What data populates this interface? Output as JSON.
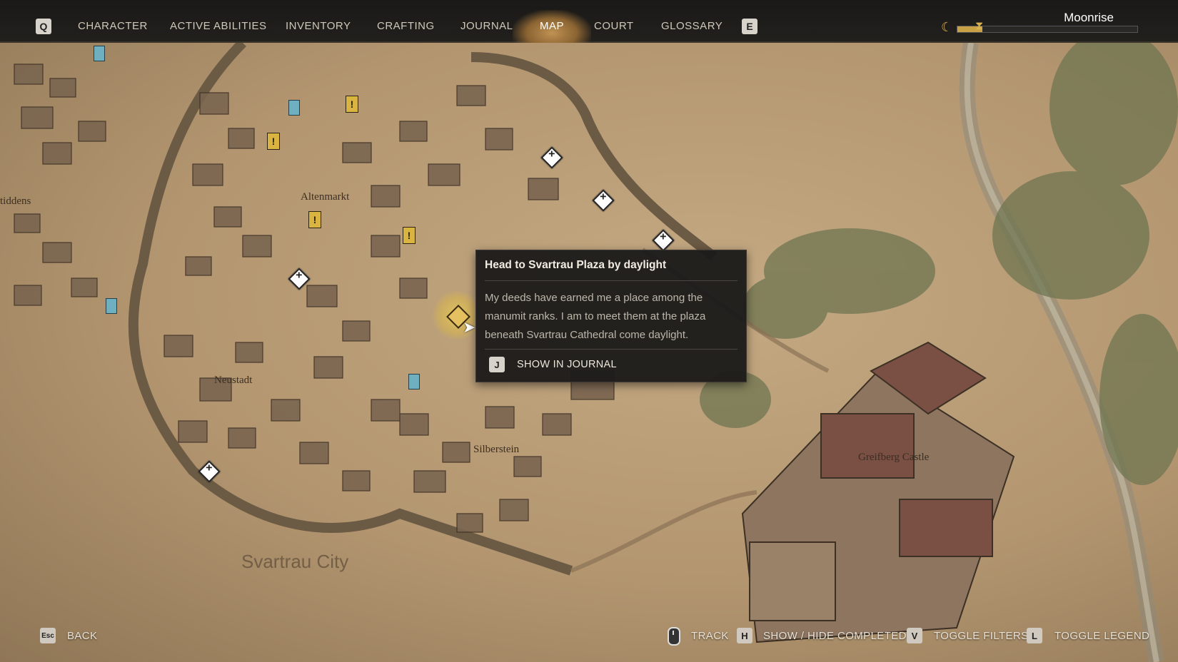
{
  "nav": {
    "left_key": "Q",
    "right_key": "E",
    "tabs": [
      {
        "label": "CHARACTER",
        "active": false
      },
      {
        "label": "ACTIVE ABILITIES",
        "active": false
      },
      {
        "label": "INVENTORY",
        "active": false
      },
      {
        "label": "CRAFTING",
        "active": false
      },
      {
        "label": "JOURNAL",
        "active": false
      },
      {
        "label": "MAP",
        "active": true
      },
      {
        "label": "COURT",
        "active": false
      },
      {
        "label": "GLOSSARY",
        "active": false
      }
    ],
    "time_of_day": "Moonrise",
    "time_progress": 0.14
  },
  "tooltip": {
    "title": "Head to Svartrau Plaza by daylight",
    "description": "My deeds have earned me a place among the manumit ranks. I am to meet them at the plaza beneath Svartrau Cathedral come daylight.",
    "action_key": "J",
    "action_label": "SHOW IN JOURNAL"
  },
  "map_labels": {
    "altenmarkt": "Altenmarkt",
    "neustadt": "Neustadt",
    "silberstein": "Silberstein",
    "greifberg": "Greifberg Castle",
    "city": "Svartrau City",
    "edge": "tiddens"
  },
  "controls": {
    "back_key": "Esc",
    "back_label": "BACK",
    "track_label": "TRACK",
    "completed_key": "H",
    "completed_label": "SHOW / HIDE COMPLETED",
    "filters_key": "V",
    "filters_label": "TOGGLE FILTERS",
    "legend_key": "L",
    "legend_label": "TOGGLE LEGEND"
  },
  "colors": {
    "parchment": "#b89c74",
    "ink": "#3b2e21",
    "quest_highlight": "#e4c060",
    "church_marker": "#6fb0c0"
  }
}
